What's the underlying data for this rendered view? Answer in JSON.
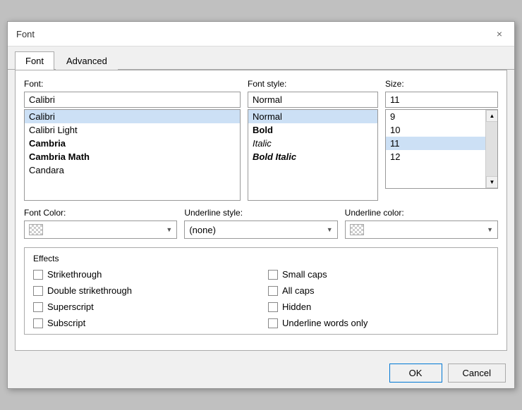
{
  "dialog": {
    "title": "Font",
    "close_label": "×"
  },
  "tabs": [
    {
      "label": "Font",
      "active": true
    },
    {
      "label": "Advanced",
      "active": false
    }
  ],
  "font_section": {
    "font_label": "Font:",
    "font_style_label": "Font style:",
    "size_label": "Size:"
  },
  "font_list": [
    {
      "name": "Calibri",
      "selected": true,
      "style": ""
    },
    {
      "name": "Calibri Light",
      "selected": false,
      "style": ""
    },
    {
      "name": "Cambria",
      "selected": false,
      "style": "bold"
    },
    {
      "name": "Cambria Math",
      "selected": false,
      "style": "bold"
    },
    {
      "name": "Candara",
      "selected": false,
      "style": ""
    }
  ],
  "font_style_list": [
    {
      "name": "Normal",
      "selected": true,
      "style": ""
    },
    {
      "name": "Bold",
      "selected": false,
      "style": "bold"
    },
    {
      "name": "Italic",
      "selected": false,
      "style": "italic"
    },
    {
      "name": "Bold Italic",
      "selected": false,
      "style": "bold-italic"
    }
  ],
  "size_input_value": "11",
  "size_list": [
    {
      "value": "9"
    },
    {
      "value": "10"
    },
    {
      "value": "11",
      "selected": true
    },
    {
      "value": "12"
    }
  ],
  "color_section": {
    "font_color_label": "Font Color:",
    "underline_style_label": "Underline style:",
    "underline_style_value": "(none)",
    "underline_color_label": "Underline color:"
  },
  "effects_section": {
    "title": "Effects",
    "col1": [
      {
        "label": "Strikethrough",
        "checked": false
      },
      {
        "label": "Double strikethrough",
        "checked": false
      },
      {
        "label": "Superscript",
        "checked": false
      },
      {
        "label": "Subscript",
        "checked": false
      }
    ],
    "col2": [
      {
        "label": "Small caps",
        "checked": false
      },
      {
        "label": "All caps",
        "checked": false
      },
      {
        "label": "Hidden",
        "checked": false
      },
      {
        "label": "Underline words only",
        "checked": false
      }
    ]
  },
  "footer": {
    "ok_label": "OK",
    "cancel_label": "Cancel"
  }
}
